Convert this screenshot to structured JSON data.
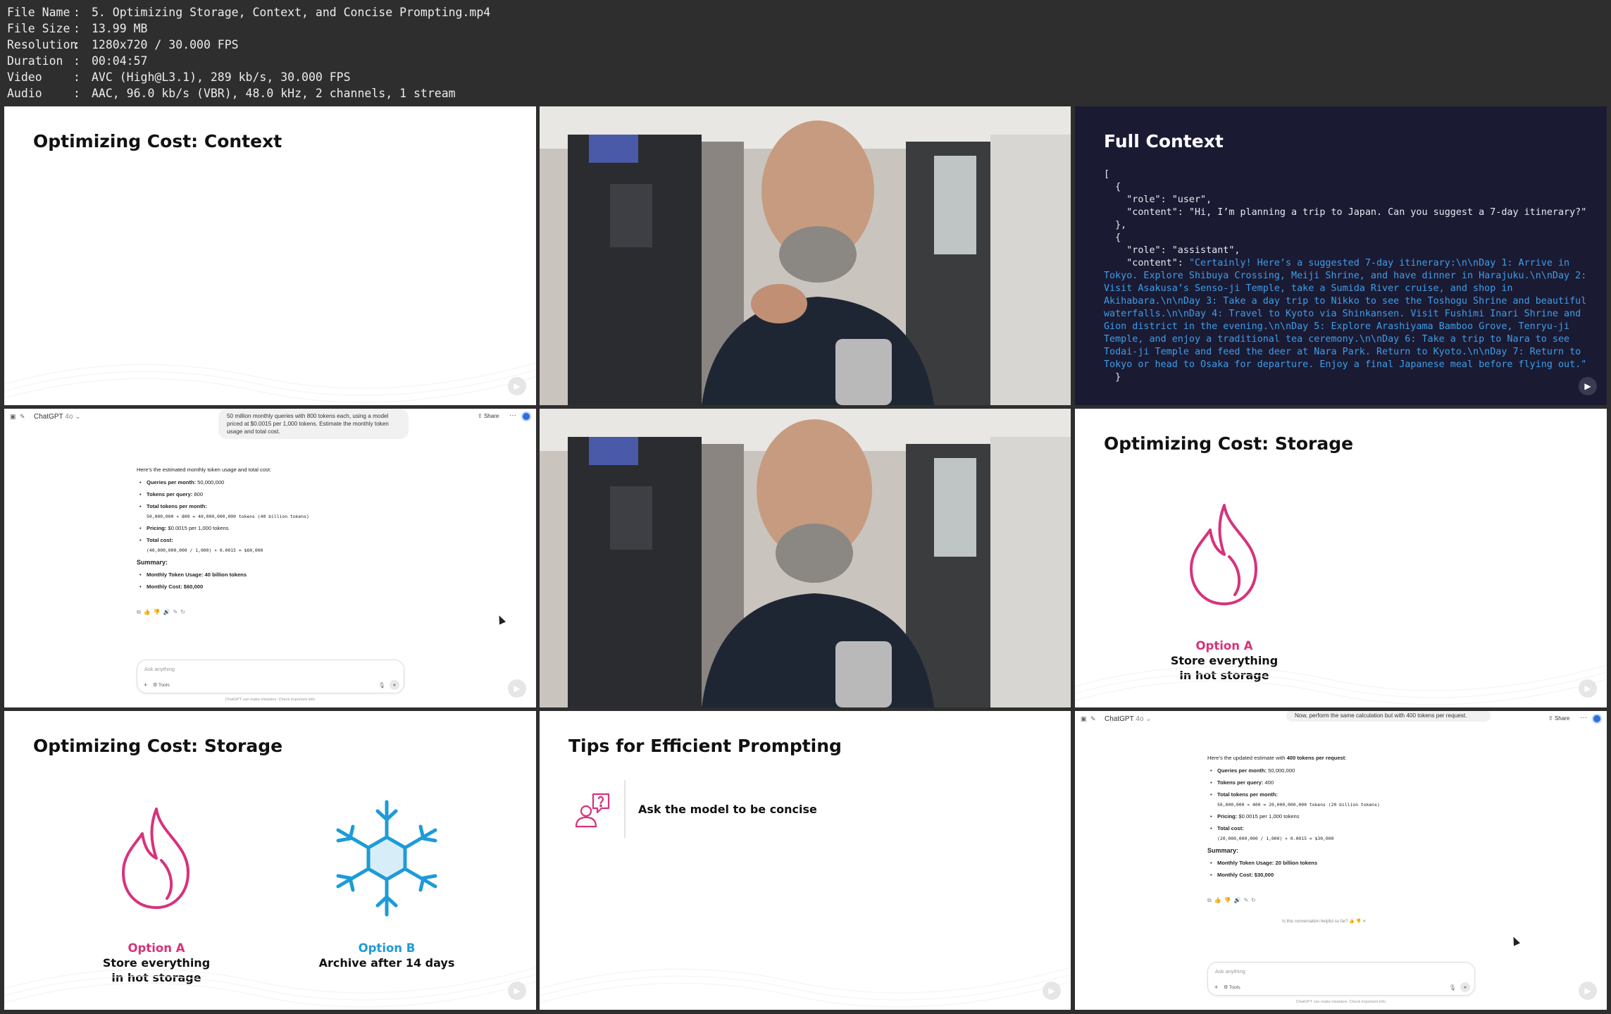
{
  "meta": [
    {
      "key": "File Name",
      "value": "5. Optimizing Storage, Context, and Concise Prompting.mp4"
    },
    {
      "key": "File Size",
      "value": "13.99 MB"
    },
    {
      "key": "Resolution",
      "value": "1280x720 / 30.000 FPS"
    },
    {
      "key": "Duration",
      "value": "00:04:57"
    },
    {
      "key": "Video",
      "value": "AVC (High@L3.1), 289 kb/s, 30.000 FPS"
    },
    {
      "key": "Audio",
      "value": "AAC, 96.0 kb/s (VBR), 48.0 kHz, 2 channels, 1 stream"
    }
  ],
  "tile1": {
    "title": "Optimizing Cost: Context"
  },
  "tile3": {
    "title": "Full Context",
    "lines": [
      "[",
      "  {",
      "    \"role\": \"user\",",
      "    \"content\": \"Hi, I’m planning a trip to Japan. Can you suggest a 7-day itinerary?\"",
      "  },",
      "  {",
      "    \"role\": \"assistant\",",
      "    \"content\": "
    ],
    "assistant_content": "\"Certainly! Here’s a suggested 7-day itinerary:\\n\\nDay 1: Arrive in Tokyo. Explore Shibuya Crossing, Meiji Shrine, and have dinner in Harajuku.\\n\\nDay 2: Visit Asakusa’s Senso-ji Temple, take a Sumida River cruise, and shop in Akihabara.\\n\\nDay 3: Take a day trip to Nikko to see the Toshogu Shrine and beautiful waterfalls.\\n\\nDay 4: Travel to Kyoto via Shinkansen. Visit Fushimi Inari Shrine and Gion district in the evening.\\n\\nDay 5: Explore Arashiyama Bamboo Grove, Tenryu-ji Temple, and enjoy a traditional tea ceremony.\\n\\nDay 6: Take a trip to Nara to see Todai-ji Temple and feed the deer at Nara Park. Return to Kyoto.\\n\\nDay 7: Return to Tokyo or head to Osaka for departure. Enjoy a final Japanese meal before flying out.\"",
    "tail": "  }"
  },
  "chat1": {
    "brand": "ChatGPT",
    "version": "4o",
    "share": "Share",
    "question": "50 million monthly queries with 800 tokens each, using a model priced at $0.0015 per 1,000 tokens. Estimate the monthly token usage and total cost.",
    "intro": "Here’s the estimated monthly token usage and total cost:",
    "items": [
      {
        "label": "Queries per month:",
        "value": " 50,000,000",
        "sub": ""
      },
      {
        "label": "Tokens per query:",
        "value": " 800",
        "sub": ""
      },
      {
        "label": "Total tokens per month:",
        "value": "",
        "sub": "50,000,000 × 800 = 40,000,000,000 tokens (40 billion tokens)"
      },
      {
        "label": "Pricing:",
        "value": " $0.0015 per 1,000 tokens",
        "sub": ""
      },
      {
        "label": "Total cost:",
        "value": "",
        "sub": "(40,000,000,000 / 1,000) × 0.0015 = $60,000"
      }
    ],
    "summary_head": "Summary:",
    "summary": [
      "Monthly Token Usage: 40 billion tokens",
      "Monthly Cost: $60,000"
    ],
    "input_placeholder": "Ask anything",
    "tools": "Tools",
    "disclaimer": "ChatGPT can make mistakes. Check important info."
  },
  "tile6": {
    "title": "Optimizing Cost: Storage",
    "option_a_name": "Option A",
    "option_a_desc1": "Store everything",
    "option_a_desc2": "in hot storage"
  },
  "tile7": {
    "title": "Optimizing Cost: Storage",
    "option_a_name": "Option A",
    "option_a_desc1": "Store everything",
    "option_a_desc2": "in hot storage",
    "option_b_name": "Option B",
    "option_b_desc1": "Archive after 14 days"
  },
  "tile8": {
    "title": "Tips for Efficient Prompting",
    "tip": "Ask the model to be concise"
  },
  "chat2": {
    "brand": "ChatGPT",
    "version": "4o",
    "share": "Share",
    "question": "Now, perform the same calculation but with 400 tokens per request.",
    "intro_pre": "Here’s the updated estimate with ",
    "intro_bold": "400 tokens per request",
    "intro_post": ":",
    "items": [
      {
        "label": "Queries per month:",
        "value": " 50,000,000",
        "sub": ""
      },
      {
        "label": "Tokens per query:",
        "value": " 400",
        "sub": ""
      },
      {
        "label": "Total tokens per month:",
        "value": "",
        "sub": "50,000,000 × 400 = 20,000,000,000 tokens (20 billion tokens)"
      },
      {
        "label": "Pricing:",
        "value": " $0.0015 per 1,000 tokens",
        "sub": ""
      },
      {
        "label": "Total cost:",
        "value": "",
        "sub": "(20,000,000,000 / 1,000) × 0.0015 = $30,000"
      }
    ],
    "summary_head": "Summary:",
    "summary": [
      "Monthly Token Usage: 20 billion tokens",
      "Monthly Cost: $30,000"
    ],
    "helpful": "Is this conversation helpful so far?",
    "input_placeholder": "Ask anything",
    "tools": "Tools",
    "disclaimer": "ChatGPT can make mistakes. Check important info."
  },
  "colors": {
    "pink": "#d6337b",
    "cyan": "#1e9bd7",
    "code_blue": "#3d9ee8",
    "code_bg": "#1b1a33"
  }
}
